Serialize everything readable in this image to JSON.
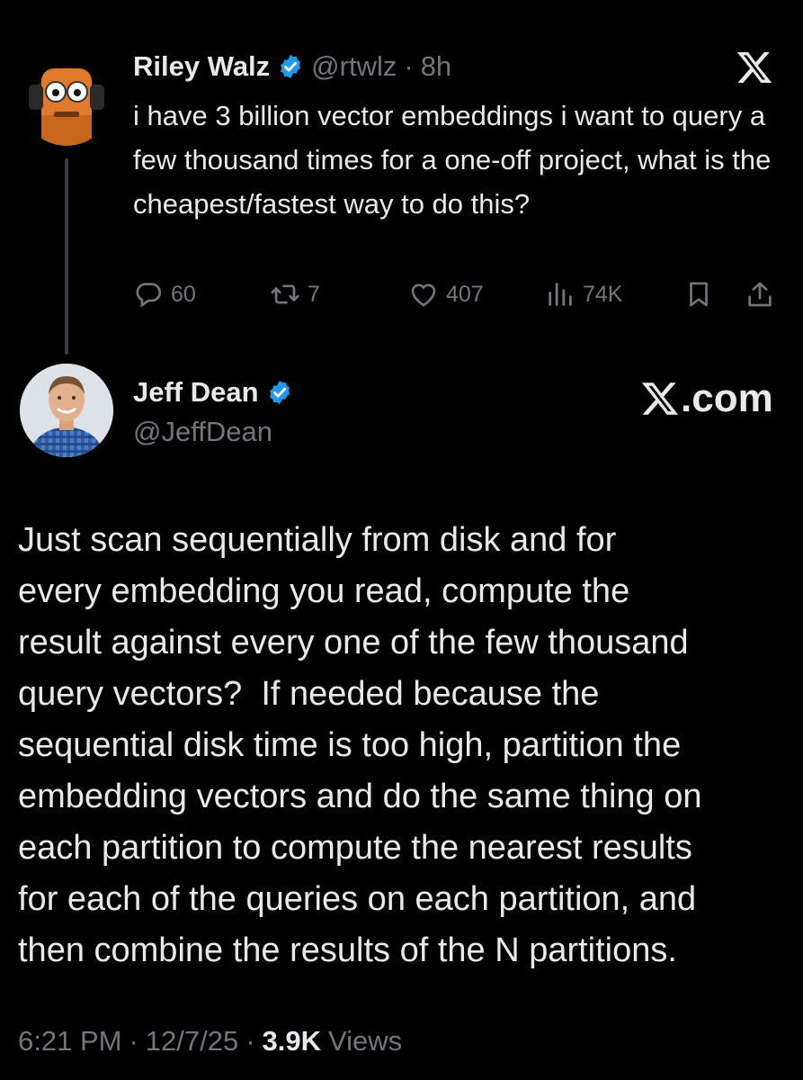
{
  "parent_tweet": {
    "author_name": "Riley Walz",
    "handle": "@rtwlz",
    "separator": "·",
    "age": "8h",
    "text": "i have 3 billion vector embeddings i want to query a few thousand times for a one-off project, what is the cheapest/fastest way to do this?",
    "actions": {
      "replies": "60",
      "reposts": "7",
      "likes": "407",
      "views": "74K"
    },
    "icons": {
      "platform": "x-logo-icon",
      "verified": "verified-badge-icon",
      "reply": "reply-icon",
      "repost": "repost-icon",
      "like": "heart-icon",
      "views": "views-chart-icon",
      "bookmark": "bookmark-icon",
      "share": "share-icon"
    }
  },
  "main_tweet": {
    "author_name": "Jeff Dean",
    "handle": "@JeffDean",
    "watermark": ".com",
    "text_lines": [
      "Just scan sequentially from disk and for",
      "every embedding you read, compute the",
      "result against every one of the few thousand",
      "query vectors?  If needed because the",
      "sequential disk time is too high, partition the",
      "embedding vectors and do the same thing on",
      "each partition to compute the nearest results",
      "for each of the queries on each partition, and",
      "then combine the results of the N partitions."
    ],
    "footer": {
      "time": "6:21 PM",
      "sep1": "·",
      "date": "12/7/25",
      "sep2": "·",
      "views_count": "3.9K",
      "views_label": "Views"
    }
  },
  "colors": {
    "background": "#000000",
    "text": "#e7e9ea",
    "muted": "#71767b",
    "verified": "#1d9bf0",
    "thread_line": "#3a3d41"
  }
}
